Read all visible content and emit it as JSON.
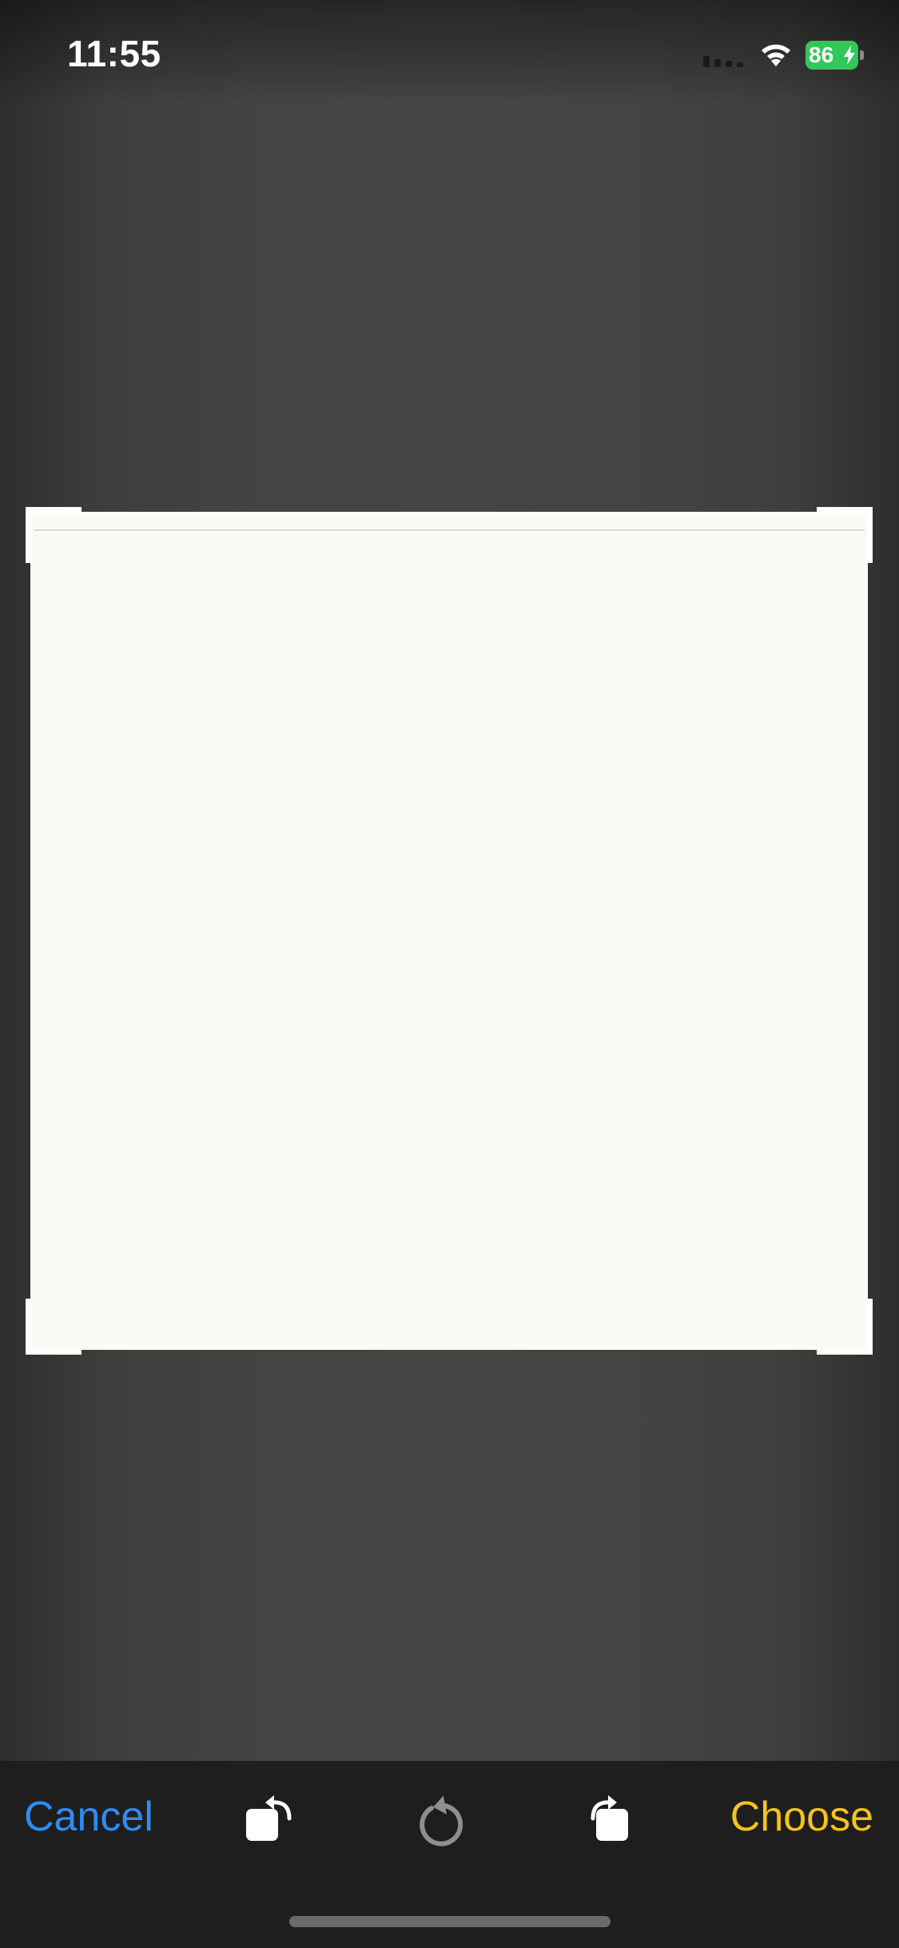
{
  "status_bar": {
    "time": "11:55",
    "battery_percent": "86",
    "battery_color": "#32c759",
    "icons": [
      "signal-icon",
      "wifi-icon",
      "battery-icon",
      "bolt-icon"
    ]
  },
  "crop": {
    "image_background": "#fbfbf5",
    "frame_color": "#ffffff"
  },
  "toolbar": {
    "cancel_label": "Cancel",
    "choose_label": "Choose",
    "cancel_color": "#2f8cf2",
    "choose_color": "#f6c417",
    "tools": [
      "rotate-left-icon",
      "reset-rotation-icon",
      "rotate-right-icon"
    ]
  }
}
